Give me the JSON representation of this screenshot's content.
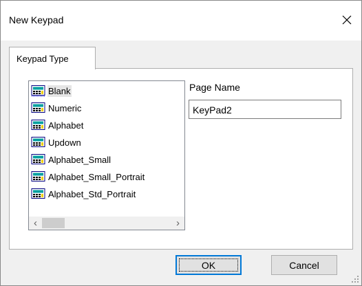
{
  "window": {
    "title": "New Keypad"
  },
  "tab": {
    "label": "Keypad Type"
  },
  "list": {
    "items": [
      {
        "label": "Blank",
        "selected": true
      },
      {
        "label": "Numeric"
      },
      {
        "label": "Alphabet"
      },
      {
        "label": "Updown"
      },
      {
        "label": "Alphabet_Small"
      },
      {
        "label": "Alphabet_Small_Portrait"
      },
      {
        "label": "Alphabet_Std_Portrait"
      }
    ],
    "icon": "keypad-page-icon"
  },
  "page_name": {
    "label": "Page Name",
    "value": "KeyPad2"
  },
  "buttons": {
    "ok": "OK",
    "cancel": "Cancel"
  },
  "colors": {
    "focus_border": "#0078d7",
    "dialog_bg": "#f0f0f0"
  }
}
